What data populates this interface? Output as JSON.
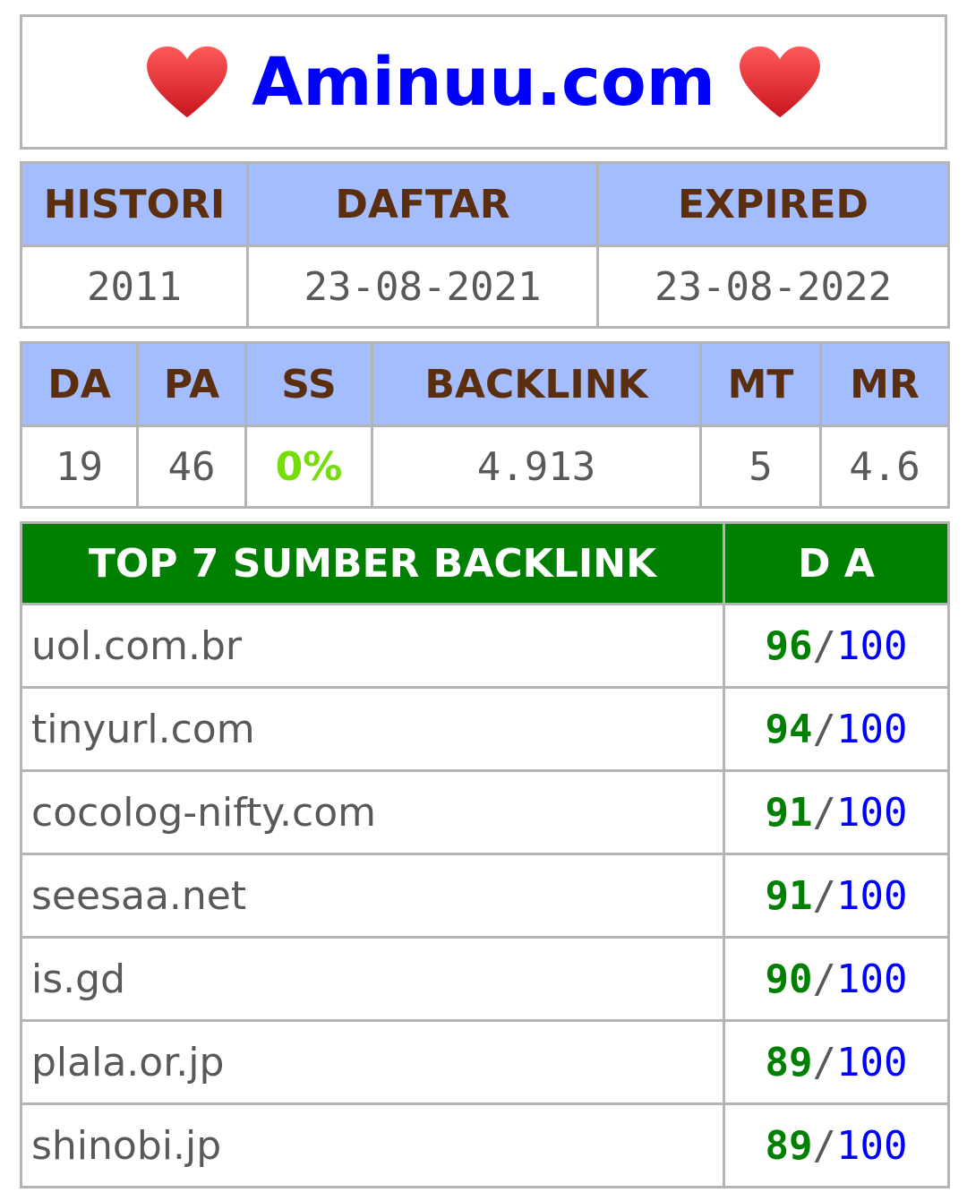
{
  "title": "Aminuu.com",
  "colors": {
    "title": "#0000ff",
    "header_bg": "#a3bdff",
    "header_text": "#5a2e0e",
    "ss_value": "#75dd09",
    "backlink_header_bg": "#008000",
    "score": "#008000",
    "score_max": "#0000ff"
  },
  "icons": {
    "left": "red-heart-icon",
    "right": "red-heart-icon"
  },
  "history": {
    "headers": [
      "HISTORI",
      "DAFTAR",
      "EXPIRED"
    ],
    "values": [
      "2011",
      "23-08-2021",
      "23-08-2022"
    ]
  },
  "metrics": {
    "headers": [
      "DA",
      "PA",
      "SS",
      "BACKLINK",
      "MT",
      "MR"
    ],
    "values": [
      "19",
      "46",
      "0%",
      "4.913",
      "5",
      "4.6"
    ]
  },
  "backlinks": {
    "header_source": "TOP 7 SUMBER BACKLINK",
    "header_da": "D A",
    "rows": [
      {
        "domain": "uol.com.br",
        "da": "96",
        "max": "100"
      },
      {
        "domain": "tinyurl.com",
        "da": "94",
        "max": "100"
      },
      {
        "domain": "cocolog-nifty.com",
        "da": "91",
        "max": "100"
      },
      {
        "domain": "seesaa.net",
        "da": "91",
        "max": "100"
      },
      {
        "domain": "is.gd",
        "da": "90",
        "max": "100"
      },
      {
        "domain": "plala.or.jp",
        "da": "89",
        "max": "100"
      },
      {
        "domain": "shinobi.jp",
        "da": "89",
        "max": "100"
      }
    ]
  }
}
